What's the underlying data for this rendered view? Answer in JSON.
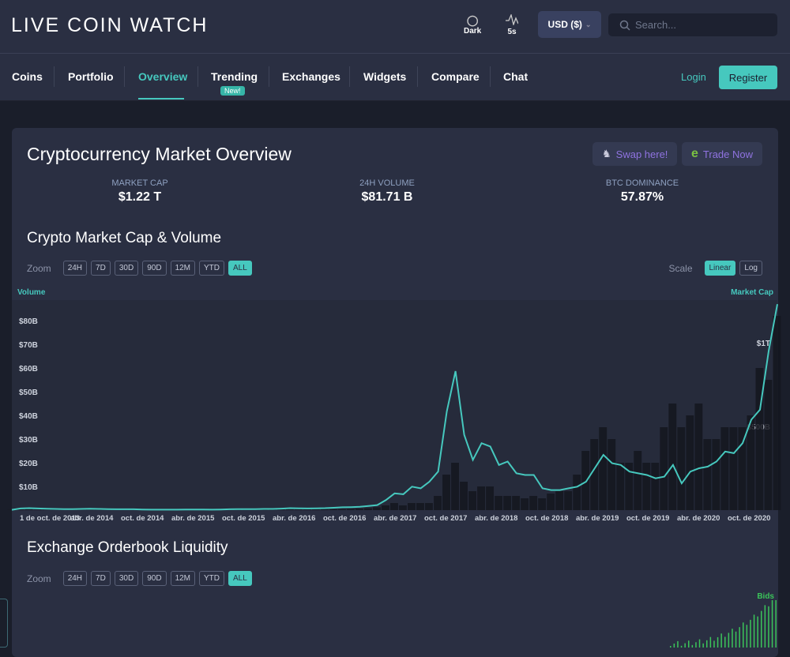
{
  "brand": {
    "logo": "LIVE COIN WATCH"
  },
  "header": {
    "theme_label": "Dark",
    "refresh_label": "5s",
    "currency": "USD ($)",
    "search_placeholder": "Search..."
  },
  "nav": {
    "items": [
      {
        "label": "Coins"
      },
      {
        "label": "Portfolio"
      },
      {
        "label": "Overview"
      },
      {
        "label": "Trending"
      },
      {
        "label": "Exchanges"
      },
      {
        "label": "Widgets"
      },
      {
        "label": "Compare"
      },
      {
        "label": "Chat"
      }
    ],
    "new_badge": "New!",
    "login": "Login",
    "register": "Register"
  },
  "overview": {
    "title": "Cryptocurrency Market Overview",
    "swap": "Swap here!",
    "trade": "Trade Now",
    "stats": [
      {
        "label": "MARKET CAP",
        "value": "$1.22 T"
      },
      {
        "label": "24H VOLUME",
        "value": "$81.71 B"
      },
      {
        "label": "BTC DOMINANCE",
        "value": "57.87%"
      }
    ]
  },
  "zoom": {
    "label": "Zoom",
    "options": [
      "24H",
      "7D",
      "30D",
      "90D",
      "12M",
      "YTD",
      "ALL"
    ],
    "selected": "ALL"
  },
  "scale": {
    "label": "Scale",
    "options": [
      "Linear",
      "Log"
    ],
    "selected": "Linear"
  },
  "section1": {
    "title": "Crypto Market Cap & Volume"
  },
  "section2": {
    "title": "Exchange Orderbook Liquidity",
    "bids_label": "Bids"
  },
  "colors": {
    "accent": "#46c8be",
    "bids": "#3bc45a"
  },
  "chart_data": {
    "type": "line+bar",
    "left_axis_title": "Volume",
    "right_axis_title": "Market Cap",
    "left_ticks": [
      "$10B",
      "$20B",
      "$30B",
      "$40B",
      "$50B",
      "$60B",
      "$70B",
      "$80B"
    ],
    "right_ticks": [
      "$500B",
      "$1T"
    ],
    "x_labels": [
      "1 de oct. de 2013",
      "abr. de 2014",
      "oct. de 2014",
      "abr. de 2015",
      "oct. de 2015",
      "abr. de 2016",
      "oct. de 2016",
      "abr. de 2017",
      "oct. de 2017",
      "abr. de 2018",
      "oct. de 2018",
      "abr. de 2019",
      "oct. de 2019",
      "abr. de 2020",
      "oct. de 2020"
    ],
    "x_start": "2013-10",
    "x_step": "month",
    "market_cap_billions": [
      2,
      10,
      12,
      10,
      8,
      7,
      6,
      6,
      7,
      8,
      7,
      6,
      5,
      5,
      5,
      4,
      3,
      3,
      3,
      3,
      4,
      4,
      4,
      3,
      4,
      5,
      6,
      6,
      6,
      7,
      7,
      9,
      12,
      11,
      10,
      11,
      12,
      14,
      17,
      18,
      20,
      25,
      30,
      60,
      100,
      95,
      140,
      130,
      170,
      230,
      590,
      830,
      450,
      300,
      400,
      380,
      270,
      290,
      220,
      210,
      210,
      130,
      120,
      120,
      130,
      140,
      170,
      250,
      330,
      280,
      270,
      230,
      220,
      210,
      190,
      200,
      270,
      160,
      230,
      250,
      260,
      290,
      350,
      340,
      400,
      540,
      600,
      950,
      1230
    ],
    "volume_billions": [
      0.1,
      0.3,
      0.4,
      0.2,
      0.2,
      0.1,
      0.1,
      0.1,
      0.1,
      0.1,
      0.1,
      0.1,
      0.1,
      0.1,
      0.1,
      0.1,
      0.1,
      0.1,
      0.1,
      0.1,
      0.1,
      0.2,
      0.2,
      0.1,
      0.2,
      0.2,
      0.2,
      0.2,
      0.2,
      0.2,
      0.2,
      0.3,
      0.4,
      0.3,
      0.3,
      0.3,
      0.4,
      0.4,
      0.4,
      0.5,
      0.6,
      0.8,
      1.2,
      2,
      3,
      2,
      3,
      3,
      3,
      6,
      15,
      20,
      12,
      8,
      10,
      10,
      6,
      6,
      6,
      5,
      6,
      5,
      7,
      8,
      8,
      15,
      25,
      30,
      35,
      30,
      20,
      20,
      25,
      20,
      20,
      35,
      45,
      35,
      40,
      45,
      30,
      30,
      35,
      35,
      35,
      40,
      60,
      55,
      82
    ]
  }
}
